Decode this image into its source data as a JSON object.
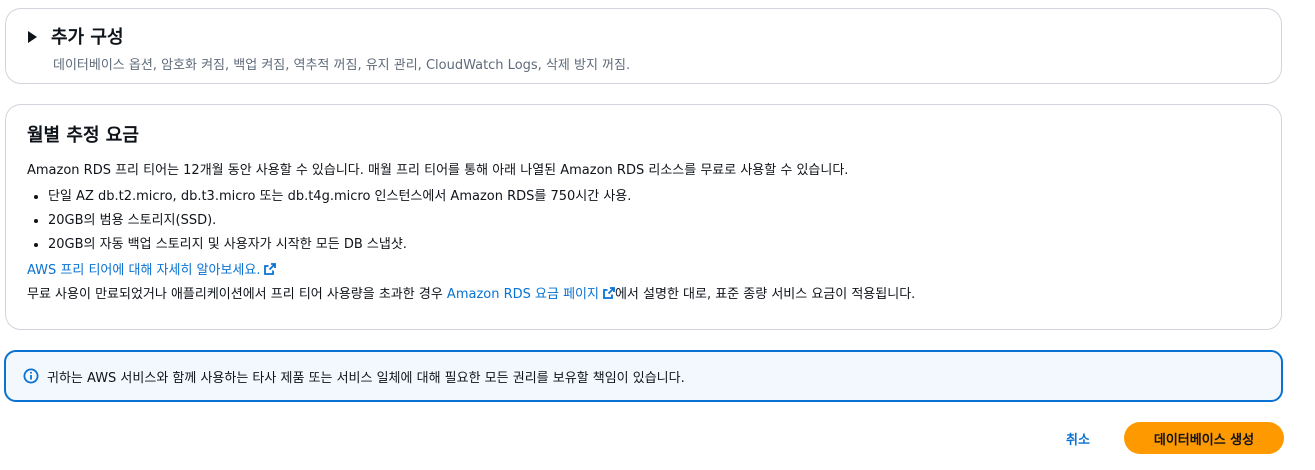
{
  "additional_config": {
    "title": "추가 구성",
    "description": "데이터베이스 옵션, 암호화 켜짐, 백업 켜짐, 역추적 꺼짐, 유지 관리, CloudWatch Logs, 삭제 방지 꺼짐."
  },
  "pricing": {
    "title": "월별 추정 요금",
    "intro": "Amazon RDS 프리 티어는 12개월 동안 사용할 수 있습니다. 매월 프리 티어를 통해 아래 나열된 Amazon RDS 리소스를 무료로 사용할 수 있습니다.",
    "items": [
      "단일 AZ db.t2.micro, db.t3.micro 또는 db.t4g.micro 인스턴스에서 Amazon RDS를 750시간 사용.",
      "20GB의 범용 스토리지(SSD).",
      "20GB의 자동 백업 스토리지 및 사용자가 시작한 모든 DB 스냅샷."
    ],
    "learn_more_link": "AWS 프리 티어에 대해 자세히 알아보세요.",
    "footer_before": "무료 사용이 만료되었거나 애플리케이션에서 프리 티어 사용량을 초과한 경우 ",
    "footer_link": "Amazon RDS 요금 페이지",
    "footer_after": "에서 설명한 대로, 표준 종량 서비스 요금이 적용됩니다."
  },
  "info_alert": {
    "text": "귀하는 AWS 서비스와 함께 사용하는 타사 제품 또는 서비스 일체에 대해 필요한 모든 권리를 보유할 책임이 있습니다."
  },
  "actions": {
    "cancel_label": "취소",
    "create_label": "데이터베이스 생성"
  },
  "icons": {
    "expand": "caret-right-icon",
    "external": "external-link-icon",
    "info": "info-icon"
  },
  "colors": {
    "link": "#0972d3",
    "primary_button": "#ff9900",
    "alert_border": "#0972d3",
    "alert_bg": "#f2f8fd"
  }
}
